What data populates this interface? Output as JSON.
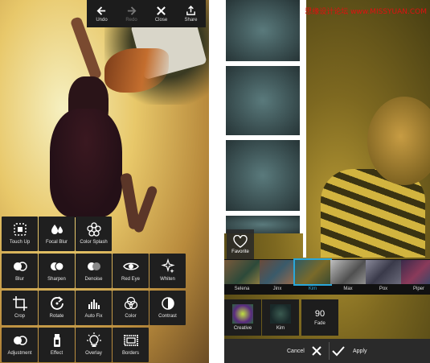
{
  "watermark": "思缘设计论坛 www.MISSYUAN.COM",
  "left_phone": {
    "toolbar": [
      {
        "label": "Undo",
        "icon": "arrow-left-icon",
        "enabled": true
      },
      {
        "label": "Redo",
        "icon": "arrow-right-icon",
        "enabled": false
      },
      {
        "label": "Close",
        "icon": "close-icon",
        "enabled": true
      },
      {
        "label": "Share",
        "icon": "share-icon",
        "enabled": true
      }
    ],
    "tools": [
      {
        "label": "Touch Up",
        "icon": "touch-up-icon"
      },
      {
        "label": "Focal Blur",
        "icon": "focal-blur-icon"
      },
      {
        "label": "Color Splash",
        "icon": "color-splash-icon"
      },
      {
        "label": "Blur",
        "icon": "blur-icon"
      },
      {
        "label": "Sharpen",
        "icon": "sharpen-icon"
      },
      {
        "label": "Denoise",
        "icon": "denoise-icon"
      },
      {
        "label": "Red Eye",
        "icon": "eye-icon"
      },
      {
        "label": "Whiten",
        "icon": "sparkle-icon"
      },
      {
        "label": "Crop",
        "icon": "crop-icon"
      },
      {
        "label": "Rotate",
        "icon": "rotate-icon"
      },
      {
        "label": "Auto Fix",
        "icon": "auto-fix-icon"
      },
      {
        "label": "Color",
        "icon": "color-icon"
      },
      {
        "label": "Contrast",
        "icon": "contrast-icon"
      },
      {
        "label": "Adjustment",
        "icon": "adjustment-icon"
      },
      {
        "label": "Effect",
        "icon": "effect-icon"
      },
      {
        "label": "Overlay",
        "icon": "bulb-icon"
      },
      {
        "label": "Borders",
        "icon": "borders-icon"
      }
    ]
  },
  "right_phone": {
    "favorite": {
      "label": "Favorite",
      "icon": "heart-icon"
    },
    "filters": [
      {
        "label": "Selena",
        "selected": false
      },
      {
        "label": "Jinx",
        "selected": false
      },
      {
        "label": "Kim",
        "selected": true
      },
      {
        "label": "Max",
        "selected": false
      },
      {
        "label": "Pox",
        "selected": false
      },
      {
        "label": "Piper",
        "selected": false
      }
    ],
    "edit_row": [
      {
        "label": "Creative"
      },
      {
        "label": "Kim"
      }
    ],
    "fade": {
      "value": "90",
      "label": "Fade"
    },
    "cancel_label": "Cancel",
    "apply_label": "Apply",
    "accent_color": "#2aa6d8"
  }
}
